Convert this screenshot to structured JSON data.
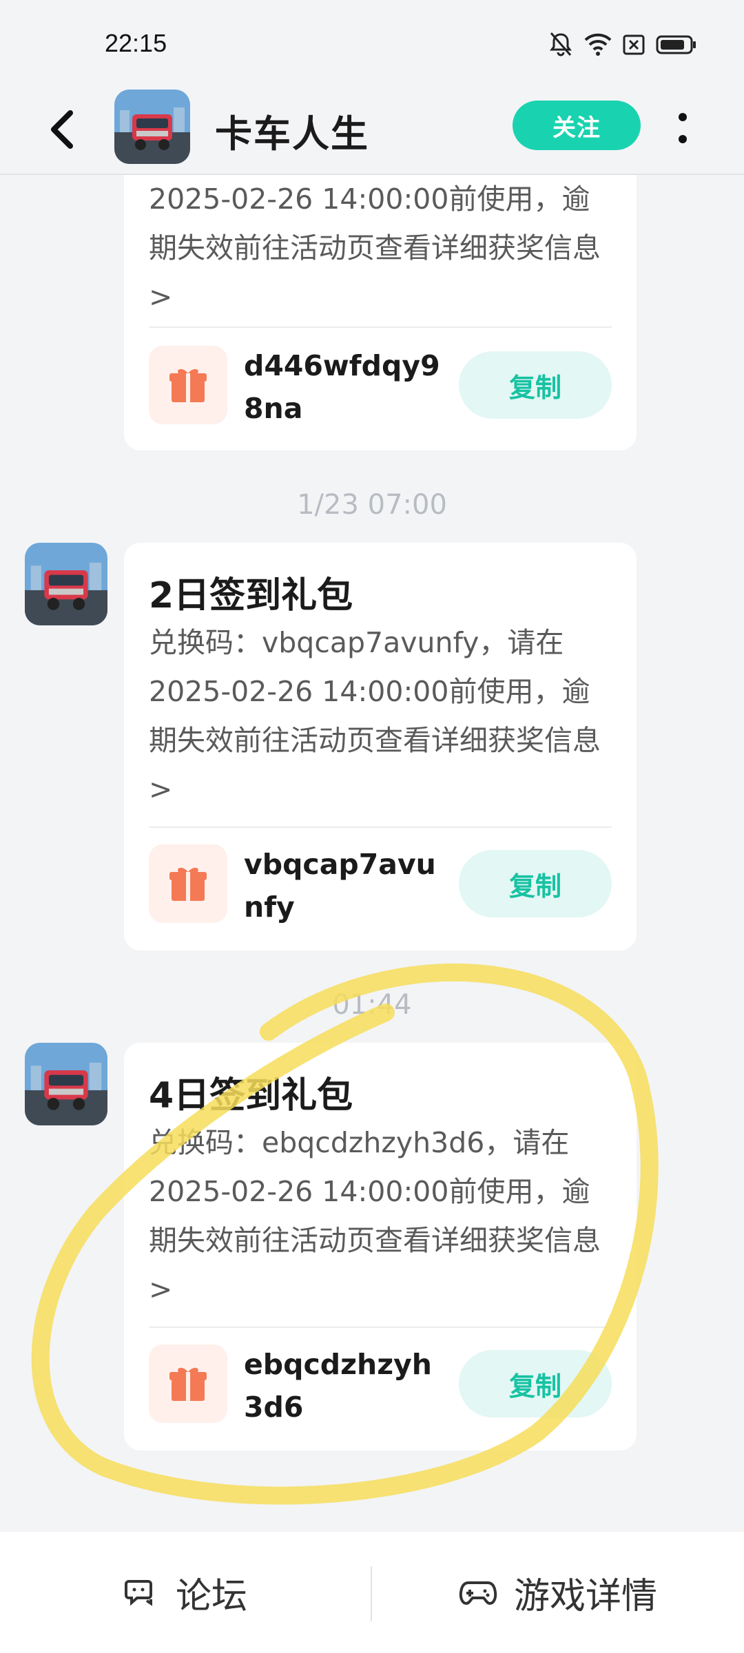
{
  "status_bar": {
    "time": "22:15"
  },
  "header": {
    "title": "卡车人生",
    "follow_label": "关注"
  },
  "messages": [
    {
      "body": "2025-02-26 14:00:00前使用，逾期失效前往活动页查看详细获奖信息>",
      "code": "d446wfdqy98na",
      "copy_label": "复制"
    },
    {
      "timestamp": "1/23  07:00",
      "title": "2日签到礼包",
      "body": "兑换码：vbqcap7avunfy，请在2025-02-26 14:00:00前使用，逾期失效前往活动页查看详细获奖信息>",
      "code": "vbqcap7avunfy",
      "copy_label": "复制"
    },
    {
      "timestamp": "01:44",
      "title": "4日签到礼包",
      "body": "兑换码：ebqcdzhzyh3d6，请在2025-02-26 14:00:00前使用，逾期失效前往活动页查看详细获奖信息>",
      "code": "ebqcdzhzyh3d6",
      "copy_label": "复制"
    }
  ],
  "bottom_bar": {
    "forum_label": "论坛",
    "details_label": "游戏详情"
  },
  "colors": {
    "accent": "#19d3b0",
    "gift": "#f47a55",
    "highlight": "#f6dd5a"
  },
  "icons": [
    "back-arrow-icon",
    "more-vertical-icon",
    "gift-icon",
    "forum-chat-icon",
    "gamepad-icon",
    "bell-muted-icon",
    "wifi-icon",
    "sim-off-icon",
    "battery-icon"
  ]
}
